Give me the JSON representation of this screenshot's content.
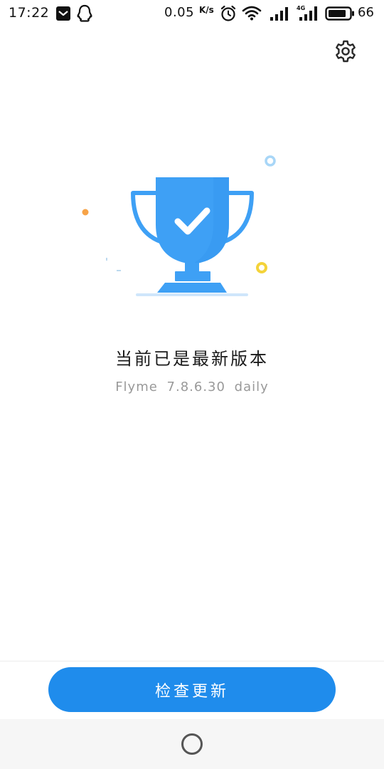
{
  "status_bar": {
    "time": "17:22",
    "net_speed": "0.05",
    "net_speed_unit": "K/s",
    "battery_level": "66",
    "icons": [
      "mail-icon",
      "qq-icon",
      "alarm-icon",
      "wifi-icon",
      "signal-icon",
      "signal-4g-icon",
      "battery-icon"
    ]
  },
  "header": {
    "settings_icon": "gear-icon"
  },
  "main": {
    "illustration": "trophy-check-icon",
    "status_title": "当前已是最新版本",
    "version": "Flyme 7.8.6.30 daily"
  },
  "actions": {
    "check_update_label": "检查更新"
  },
  "nav_bar": {
    "home_icon": "home-circle-icon"
  },
  "colors": {
    "accent": "#1f8cec",
    "trophy": "#3ea0f5",
    "text_primary": "#1a1a1a",
    "text_secondary": "#999999",
    "nav_bg": "#f6f6f6"
  }
}
